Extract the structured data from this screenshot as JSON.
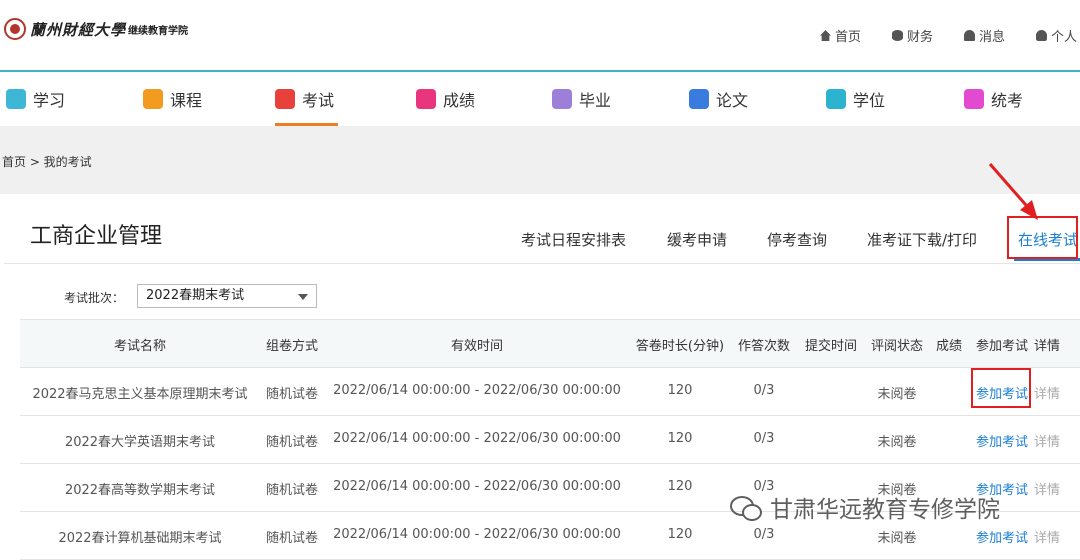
{
  "header": {
    "logo_title": "蘭州財經大學",
    "logo_sub": "继续教育学院",
    "links": [
      {
        "label": "首页",
        "icon": "home-icon"
      },
      {
        "label": "财务",
        "icon": "database-icon"
      },
      {
        "label": "消息",
        "icon": "bell-icon"
      },
      {
        "label": "个人",
        "icon": "user-icon"
      }
    ]
  },
  "mainnav": {
    "items": [
      {
        "label": "学习",
        "icon": "study-icon",
        "color": "#3cb8d6"
      },
      {
        "label": "课程",
        "icon": "course-icon",
        "color": "#f39a21"
      },
      {
        "label": "考试",
        "icon": "exam-icon",
        "color": "#e8413c"
      },
      {
        "label": "成绩",
        "icon": "score-icon",
        "color": "#e8357d"
      },
      {
        "label": "毕业",
        "icon": "graduate-icon",
        "color": "#9b7fd8"
      },
      {
        "label": "论文",
        "icon": "paper-icon",
        "color": "#3a7be0"
      },
      {
        "label": "学位",
        "icon": "degree-icon",
        "color": "#2bb3d0"
      },
      {
        "label": "统考",
        "icon": "unified-exam-icon",
        "color": "#e24ad0"
      }
    ],
    "active": "考试"
  },
  "breadcrumb": "首页 > 我的考试",
  "panel": {
    "title": "工商企业管理",
    "tabs": [
      "考试日程安排表",
      "缓考申请",
      "停考查询",
      "准考证下载/打印",
      "在线考试"
    ],
    "active_tab": "在线考试"
  },
  "filter": {
    "label": "考试批次：",
    "value": "2022春期末考试"
  },
  "table": {
    "headers": [
      "考试名称",
      "组卷方式",
      "有效时间",
      "答卷时长(分钟)",
      "作答次数",
      "提交时间",
      "评阅状态",
      "成绩",
      "参加考试",
      "详情"
    ],
    "rows": [
      {
        "name": "2022春马克思主义基本原理期末考试",
        "mode": "随机试卷",
        "time": "2022/06/14 00:00:00 - 2022/06/30 00:00:00",
        "duration": "120",
        "attempts": "0/3",
        "submit": "",
        "status": "未阅卷",
        "score": "",
        "join": "参加考试",
        "detail": "详情"
      },
      {
        "name": "2022春大学英语期末考试",
        "mode": "随机试卷",
        "time": "2022/06/14 00:00:00 - 2022/06/30 00:00:00",
        "duration": "120",
        "attempts": "0/3",
        "submit": "",
        "status": "未阅卷",
        "score": "",
        "join": "参加考试",
        "detail": "详情"
      },
      {
        "name": "2022春高等数学期末考试",
        "mode": "随机试卷",
        "time": "2022/06/14 00:00:00 - 2022/06/30 00:00:00",
        "duration": "120",
        "attempts": "0/3",
        "submit": "",
        "status": "未阅卷",
        "score": "",
        "join": "参加考试",
        "detail": "详情"
      },
      {
        "name": "2022春计算机基础期末考试",
        "mode": "随机试卷",
        "time": "2022/06/14 00:00:00 - 2022/06/30 00:00:00",
        "duration": "120",
        "attempts": "0/3",
        "submit": "",
        "status": "未阅卷",
        "score": "",
        "join": "参加考试",
        "detail": "详情"
      }
    ]
  },
  "watermark": "甘肃华远教育专修学院",
  "colors": {
    "accent": "#1a7fd4",
    "nav_active": "#f07c23",
    "highlight": "#e02020",
    "header_line": "#3fb6c8"
  }
}
